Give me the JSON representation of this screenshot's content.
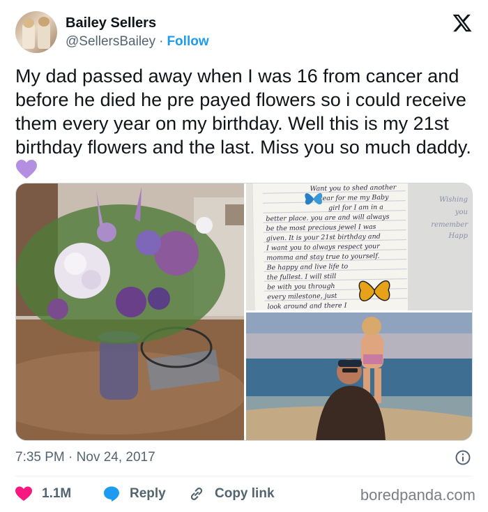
{
  "author": {
    "name": "Bailey Sellers",
    "handle": "@SellersBailey",
    "separator": "·",
    "follow_label": "Follow"
  },
  "platform_icon": "x-logo-icon",
  "tweet": {
    "text": "My dad passed away when I was 16 from cancer and before he died he pre payed flowers so i could receive them every year on my birthday. Well this is my 21st birthday flowers and the last. Miss you so much daddy.",
    "emoji": "purple-heart-icon"
  },
  "media": {
    "images": [
      {
        "icon": "flower-bouquet-photo"
      },
      {
        "icon": "handwritten-letter-photo"
      },
      {
        "icon": "father-daughter-beach-photo"
      }
    ],
    "letter_lines": [
      "Want you to shed another",
      "tear for me my Baby",
      "girl for I am in a",
      "better place. you are and will always",
      "be the most precious jewel I was",
      "given. It is your 21st birthday and",
      "I want you to always respect your",
      "momma and stay true to yourself.",
      "Be happy and live life to",
      "the fullest. I will still",
      "be with you through",
      "every milestone, just",
      "look around and there I"
    ],
    "card_words": [
      "Wishing",
      "you",
      "remember",
      "Happ"
    ]
  },
  "meta": {
    "time": "7:35 PM",
    "separator": "·",
    "date": "Nov 24, 2017"
  },
  "actions": {
    "likes": "1.1M",
    "reply_label": "Reply",
    "copy_label": "Copy link"
  },
  "colors": {
    "accent": "#1d9bf0",
    "like": "#f91880",
    "reply": "#1d9bf0",
    "heart_emoji": "#b48ee0"
  },
  "watermark": "boredpanda.com"
}
